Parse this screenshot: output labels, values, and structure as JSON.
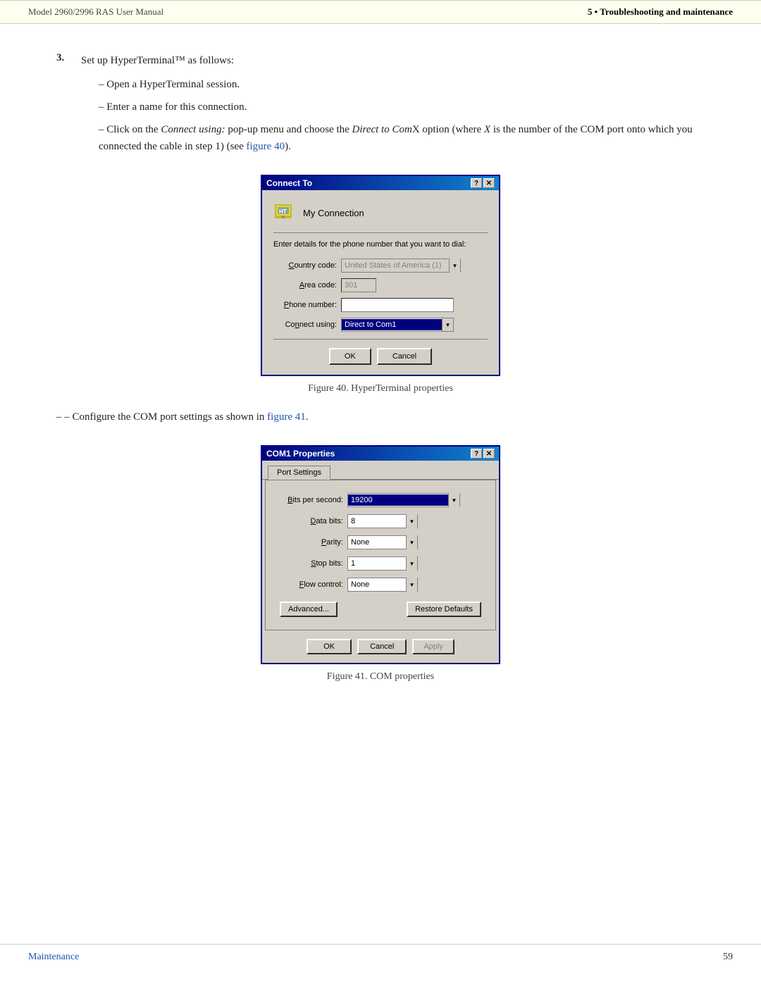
{
  "header": {
    "left": "Model 2960/2996 RAS User Manual",
    "right": "5  •  Troubleshooting and maintenance"
  },
  "step": {
    "number": "3.",
    "text": "Set up HyperTerminal™ as follows:"
  },
  "sub_items": [
    {
      "id": "open-session",
      "text": "Open a HyperTerminal session."
    },
    {
      "id": "enter-name",
      "text": "Enter a name for this connection."
    },
    {
      "id": "click-connect",
      "text_before": "Click on the ",
      "italic": "Connect using:",
      "text_middle": " pop-up menu and choose the ",
      "italic2": "Direct to Com",
      "text_after": "X option (where X is the number of the COM port onto which you connected the cable in step 1) (see figure 40)."
    }
  ],
  "figure40": {
    "caption": "Figure 40. HyperTerminal properties",
    "dialog": {
      "title": "Connect To",
      "titlebar_buttons": [
        "?",
        "×"
      ],
      "connection_name": "My Connection",
      "description": "Enter details for the phone number that you want to dial:",
      "fields": [
        {
          "label": "Country code:",
          "value": "United States of America (1)",
          "type": "select-disabled"
        },
        {
          "label": "Area code:",
          "value": "301",
          "type": "input-disabled"
        },
        {
          "label": "Phone number:",
          "value": "",
          "type": "input"
        },
        {
          "label": "Connect using:",
          "value": "Direct to Com1",
          "type": "select-highlight"
        }
      ],
      "buttons": [
        "OK",
        "Cancel"
      ]
    }
  },
  "configure_line": {
    "text_before": "Configure the COM port settings as shown in ",
    "link": "figure 41",
    "text_after": "."
  },
  "figure41": {
    "caption": "Figure 41. COM properties",
    "dialog": {
      "title": "COM1 Properties",
      "titlebar_buttons": [
        "?",
        "×"
      ],
      "tab": "Port Settings",
      "fields": [
        {
          "label": "Bits per second:",
          "value": "19200",
          "highlight": true
        },
        {
          "label": "Data bits:",
          "value": "8",
          "highlight": false
        },
        {
          "label": "Parity:",
          "value": "None",
          "highlight": false
        },
        {
          "label": "Stop bits:",
          "value": "1",
          "highlight": false
        },
        {
          "label": "Flow control:",
          "value": "None",
          "highlight": false
        }
      ],
      "advanced_btn": "Advanced...",
      "restore_btn": "Restore Defaults",
      "buttons": [
        "OK",
        "Cancel",
        "Apply"
      ]
    }
  },
  "footer": {
    "left": "Maintenance",
    "right": "59"
  }
}
